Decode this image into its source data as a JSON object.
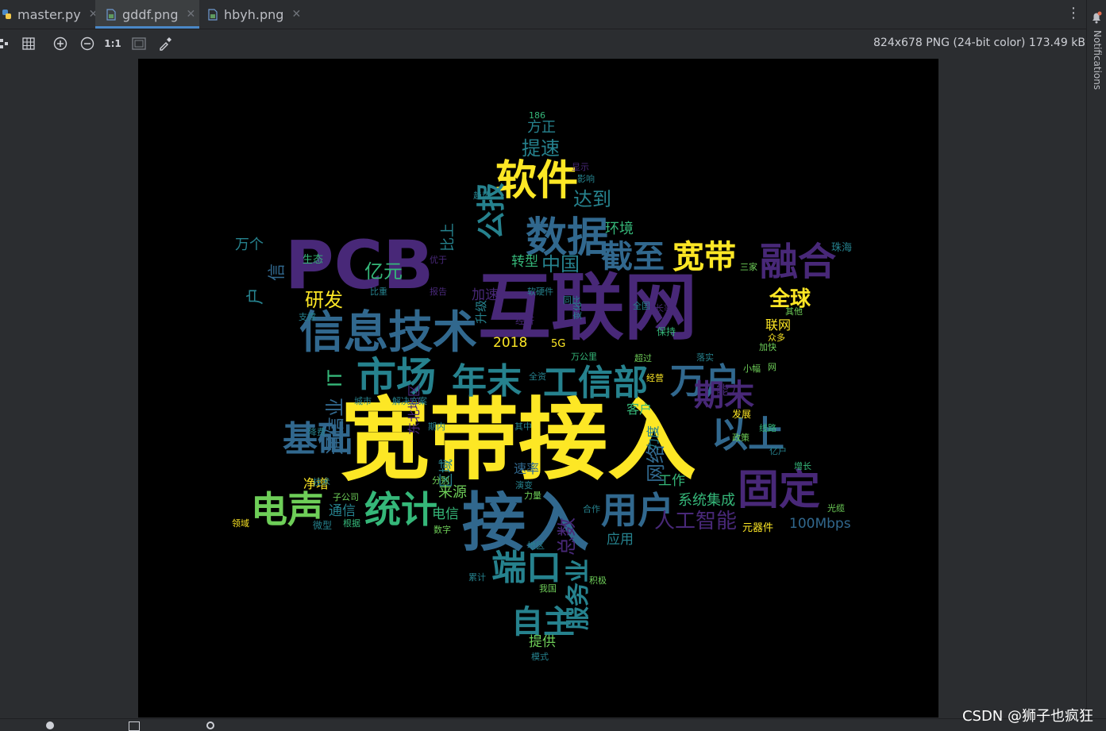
{
  "tabs": [
    {
      "label": "master.py",
      "icon": "python-file-icon"
    },
    {
      "label": "gddf.png",
      "icon": "image-file-icon",
      "active": true
    },
    {
      "label": "hbyh.png",
      "icon": "image-file-icon"
    }
  ],
  "toolbar": {
    "image_info": "824x678 PNG (24-bit color) 173.49 kB",
    "actual_size_label": "1:1"
  },
  "notifications_label": "Notifications",
  "watermark": "CSDN @狮子也疯狂",
  "colors": {
    "purple": "#482878",
    "blue": "#31688e",
    "teal": "#26828e",
    "green": "#35b779",
    "lime": "#6ece58",
    "yellow": "#fde725",
    "dark": "#440154"
  },
  "wordcloud": {
    "words": [
      "宽带接入",
      "互联网",
      "PCB",
      "接入",
      "信息技术",
      "数据",
      "软件",
      "市场",
      "年末",
      "工信部",
      "万户",
      "基础",
      "电声",
      "统计",
      "固定",
      "融合",
      "宽带",
      "截至",
      "用户",
      "以上",
      "期末",
      "公报",
      "端口",
      "自主",
      "服务业",
      "人工智能",
      "全球",
      "研发",
      "亿元",
      "中国",
      "达到",
      "提速",
      "方正",
      "环境",
      "比上",
      "通信业",
      "IT",
      "东北地区",
      "网络",
      "系统集成",
      "总数",
      "区域",
      "来源",
      "通信",
      "电信",
      "100Mbps",
      "2018",
      "5G",
      "联网",
      "万个",
      "信",
      "户",
      "生态",
      "转型",
      "提供",
      "模式",
      "应用",
      "工作",
      "客户",
      "能力",
      "速率",
      "加速",
      "经济",
      "其他",
      "三家",
      "众多",
      "加快",
      "保持",
      "超过",
      "落实",
      "小幅",
      "发展",
      "政策",
      "亿户",
      "增长",
      "线路",
      "光缆",
      "元器件",
      "净增",
      "技术",
      "子公司",
      "领域",
      "根据",
      "微型",
      "数字",
      "分别",
      "演变",
      "力量",
      "合作",
      "积极",
      "我国",
      "累计",
      "地区",
      "城市",
      "解决方案",
      "期内",
      "其中",
      "报告",
      "比重",
      "软硬件",
      "同比",
      "全国",
      "变化",
      "升级",
      "支撑",
      "万公里",
      "186",
      "趋势",
      "影响",
      "显示",
      "优于",
      "珠海",
      "降费",
      "全资",
      "经营",
      "增长率",
      "网",
      "力度"
    ]
  }
}
